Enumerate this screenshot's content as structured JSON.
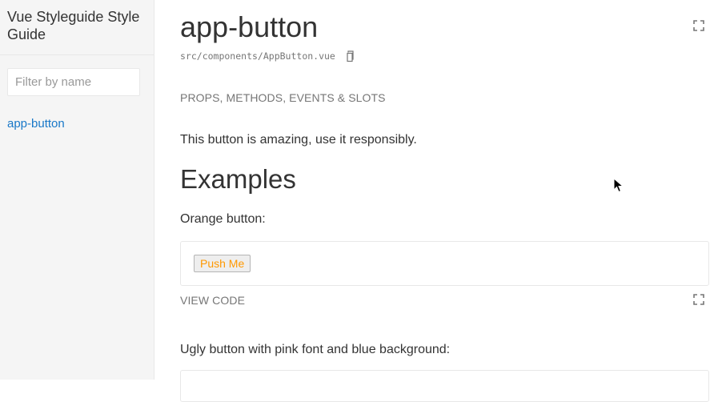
{
  "sidebar": {
    "title": "Vue Styleguide Style Guide",
    "filter": {
      "placeholder": "Filter by name",
      "value": ""
    },
    "items": [
      {
        "label": "app-button"
      }
    ]
  },
  "component": {
    "name": "app-button",
    "path": "src/components/AppButton.vue",
    "tab_label": "PROPS, METHODS, EVENTS & SLOTS",
    "description": "This button is amazing, use it responsibly."
  },
  "examples": {
    "heading": "Examples",
    "items": [
      {
        "description": "Orange button:",
        "button_label": "Push Me",
        "view_code_label": "VIEW CODE"
      },
      {
        "description": "Ugly button with pink font and blue background:"
      }
    ]
  },
  "colors": {
    "link": "#1978c8",
    "muted": "#767676",
    "text": "#333333",
    "button_text": "#ff9800",
    "sidebar_bg": "#f5f5f5",
    "border": "#e8e8e8"
  },
  "icons": {
    "fullscreen": "fullscreen-icon",
    "copy": "copy-icon",
    "cursor": "mouse-pointer-icon"
  }
}
